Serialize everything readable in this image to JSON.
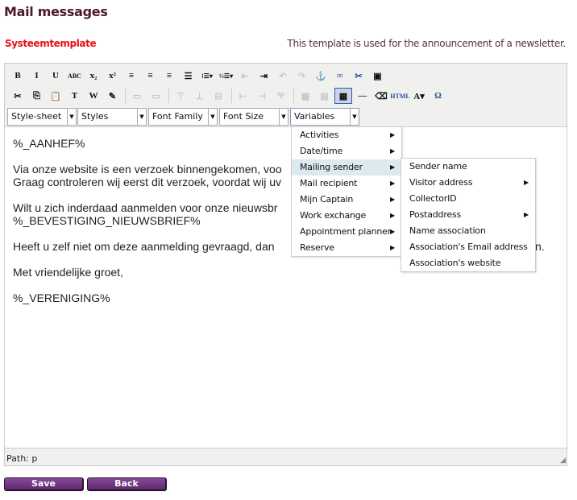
{
  "page": {
    "title": "Mail messages",
    "template_type": "Systeemtemplate",
    "description": "This template is used for the announcement of a newsletter."
  },
  "toolbar": {
    "row1": [
      {
        "icon": "bold-icon",
        "glyph": "B"
      },
      {
        "icon": "italic-icon",
        "glyph": "I"
      },
      {
        "icon": "underline-icon",
        "glyph": "U"
      },
      {
        "icon": "strikethrough-icon",
        "glyph": "ABC"
      },
      {
        "icon": "subscript-icon",
        "glyph": "x₂"
      },
      {
        "icon": "superscript-icon",
        "glyph": "x²"
      },
      {
        "icon": "align-left-icon",
        "glyph": "≡"
      },
      {
        "icon": "align-center-icon",
        "glyph": "≡"
      },
      {
        "icon": "align-right-icon",
        "glyph": "≡"
      },
      {
        "icon": "align-justify-icon",
        "glyph": "☰"
      },
      {
        "icon": "bullet-list-icon",
        "glyph": "⁝☰▾"
      },
      {
        "icon": "numbered-list-icon",
        "glyph": "⅓☰▾"
      },
      {
        "icon": "outdent-icon",
        "glyph": "⇤"
      },
      {
        "icon": "indent-icon",
        "glyph": "⇥"
      },
      {
        "icon": "undo-icon",
        "glyph": "↶"
      },
      {
        "icon": "redo-icon",
        "glyph": "↷"
      },
      {
        "icon": "anchor-icon",
        "glyph": "⚓"
      },
      {
        "icon": "link-icon",
        "glyph": "∞"
      },
      {
        "icon": "unlink-icon",
        "glyph": "✂"
      },
      {
        "icon": "image-icon",
        "glyph": "▣"
      }
    ],
    "row2": [
      {
        "icon": "cut-icon",
        "glyph": "✂"
      },
      {
        "icon": "copy-icon",
        "glyph": "⎘"
      },
      {
        "icon": "paste-icon",
        "glyph": "📋"
      },
      {
        "icon": "paste-text-icon",
        "glyph": "T"
      },
      {
        "icon": "paste-word-icon",
        "glyph": "W"
      },
      {
        "icon": "edit-icon",
        "glyph": "✎"
      },
      {
        "icon": "table-row-props-icon",
        "glyph": "▭"
      },
      {
        "icon": "table-cell-props-icon",
        "glyph": "▭"
      },
      {
        "icon": "insert-row-before-icon",
        "glyph": "⊤"
      },
      {
        "icon": "insert-row-after-icon",
        "glyph": "⊥"
      },
      {
        "icon": "delete-row-icon",
        "glyph": "⊟"
      },
      {
        "icon": "insert-col-before-icon",
        "glyph": "⊢"
      },
      {
        "icon": "insert-col-after-icon",
        "glyph": "⊣"
      },
      {
        "icon": "delete-col-icon",
        "glyph": "Ψ"
      },
      {
        "icon": "split-cells-icon",
        "glyph": "▦"
      },
      {
        "icon": "merge-cells-icon",
        "glyph": "▤"
      },
      {
        "icon": "table-icon",
        "glyph": "▦"
      },
      {
        "icon": "horizontal-rule-icon",
        "glyph": "—"
      },
      {
        "icon": "eraser-icon",
        "glyph": "⌫"
      },
      {
        "icon": "html-icon",
        "glyph": "HTML"
      },
      {
        "icon": "font-color-icon",
        "glyph": "A▾"
      },
      {
        "icon": "special-char-icon",
        "glyph": "Ω"
      }
    ],
    "selects": {
      "stylesheet": "Style-sheet",
      "styles": "Styles",
      "font_family": "Font Family",
      "font_size": "Font Size",
      "variables": "Variables"
    }
  },
  "content": {
    "lines": [
      "%_AANHEF%",
      "Via onze website is een verzoek binnengekomen, voo",
      "Graag controleren wij eerst dit verzoek, voordat wij uv",
      "Wilt u zich inderdaad aanmelden voor onze nieuwsbr",
      "%_BEVESTIGING_NIEUWSBRIEF%",
      "Heeft u zelf niet om deze aanmelding gevraagd, dan",
      "n.",
      "Met vriendelijke groet,",
      "%_VERENIGING%"
    ]
  },
  "status": {
    "path": "Path: p"
  },
  "variables_menu": {
    "items": [
      "Activities",
      "Date/time",
      "Mailing sender",
      "Mail recipient",
      "Mijn Captain",
      "Work exchange",
      "Appointment planner",
      "Reserve"
    ],
    "highlighted": "Mailing sender"
  },
  "submenu": {
    "items": [
      {
        "label": "Sender name",
        "sub": false
      },
      {
        "label": "Visitor address",
        "sub": true
      },
      {
        "label": "CollectorID",
        "sub": false
      },
      {
        "label": "Postaddress",
        "sub": true
      },
      {
        "label": "Name association",
        "sub": false
      },
      {
        "label": "Association's Email address",
        "sub": false
      },
      {
        "label": "Association's website",
        "sub": false
      }
    ]
  },
  "buttons": {
    "save": "Save",
    "back": "Back"
  },
  "colors": {
    "title": "#4a1a30",
    "template_type": "#e8101a",
    "button": "#6a3a7a",
    "menu_highlight": "#dceaf0"
  }
}
